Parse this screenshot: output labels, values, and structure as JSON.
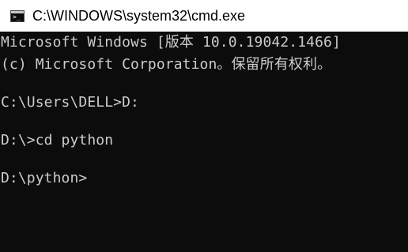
{
  "window": {
    "title": "C:\\WINDOWS\\system32\\cmd.exe",
    "icon": "cmd-console-icon"
  },
  "console": {
    "background": "#0c0c0c",
    "foreground": "#cccccc",
    "lines": [
      "Microsoft Windows [版本 10.0.19042.1466]",
      "(c) Microsoft Corporation。保留所有权利。",
      "",
      "C:\\Users\\DELL>D:",
      "",
      "D:\\>cd python",
      "",
      "D:\\python>"
    ]
  }
}
